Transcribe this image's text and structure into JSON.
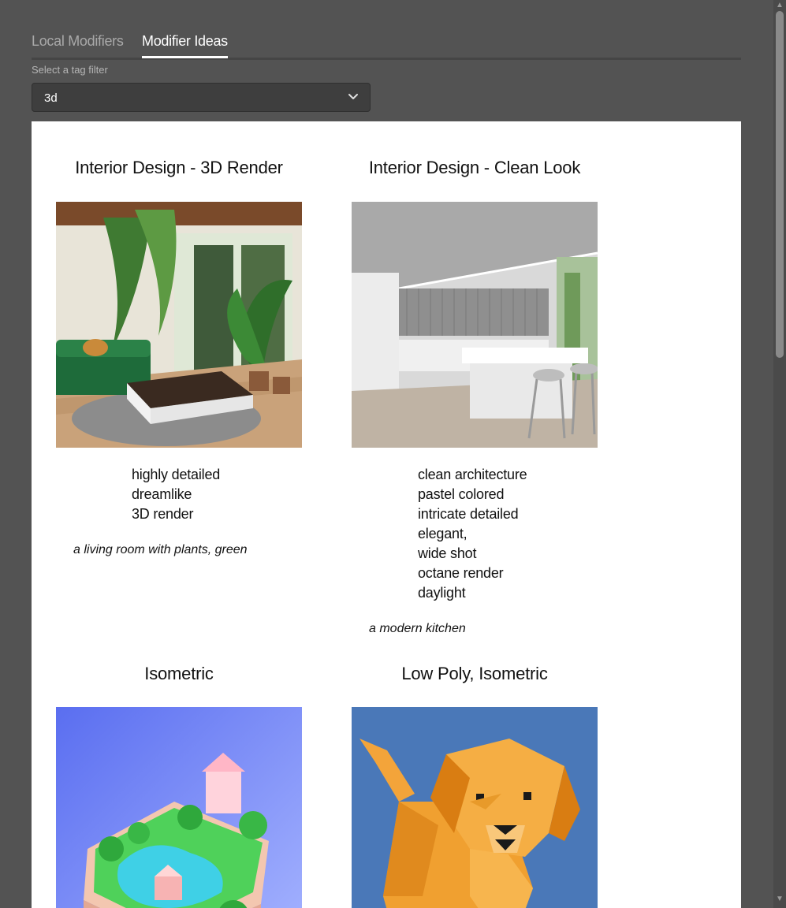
{
  "tabs": [
    {
      "label": "Local Modifiers",
      "active": false
    },
    {
      "label": "Modifier Ideas",
      "active": true
    }
  ],
  "filter": {
    "label": "Select a tag filter",
    "value": "3d"
  },
  "cards": [
    {
      "title": "Interior Design - 3D Render",
      "tags": [
        "highly detailed",
        "dreamlike",
        "3D render"
      ],
      "prompt": "a living room with plants, green",
      "image": "living-room-plants"
    },
    {
      "title": "Interior Design - Clean Look",
      "tags": [
        "clean architecture",
        "pastel colored",
        "intricate detailed",
        "elegant,",
        "wide shot",
        "octane render",
        "daylight"
      ],
      "prompt": "a modern kitchen",
      "image": "modern-kitchen"
    },
    {
      "title": "Isometric",
      "tags": [],
      "prompt": "",
      "image": "isometric-island"
    },
    {
      "title": "Low Poly, Isometric",
      "tags": [],
      "prompt": "",
      "image": "low-poly-dog"
    }
  ],
  "icons": {
    "select_chevron": "chevron-down-icon",
    "scroll_up": "arrow-up-icon",
    "scroll_down": "arrow-down-icon"
  },
  "colors": {
    "background": "#535353",
    "content_background": "#ffffff",
    "active_tab": "#ffffff",
    "inactive_tab": "#a9a9a9"
  }
}
